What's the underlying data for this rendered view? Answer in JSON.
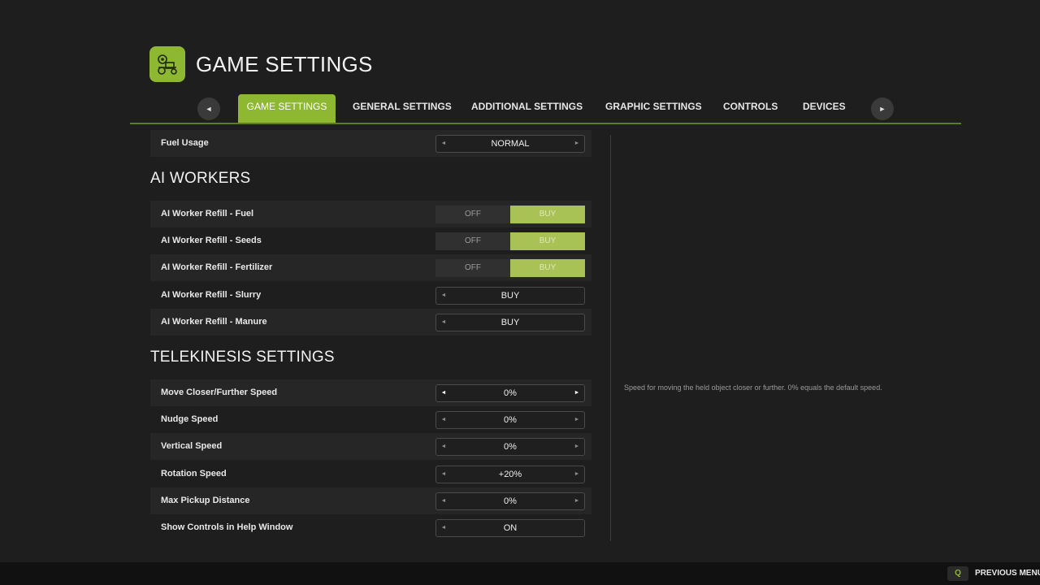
{
  "header": {
    "title": "GAME SETTINGS",
    "logo_icon": "tractor-gear-icon"
  },
  "tabs": [
    {
      "label": "GAME SETTINGS",
      "active": true
    },
    {
      "label": "GENERAL SETTINGS",
      "active": false
    },
    {
      "label": "ADDITIONAL SETTINGS",
      "active": false
    },
    {
      "label": "GRAPHIC SETTINGS",
      "active": false
    },
    {
      "label": "CONTROLS",
      "active": false
    },
    {
      "label": "DEVICES",
      "active": false
    }
  ],
  "tab_arrows": {
    "left": "◄",
    "right": "►"
  },
  "settings": {
    "fuel_usage": {
      "label": "Fuel Usage",
      "value": "NORMAL"
    },
    "ai_workers": {
      "title": "AI WORKERS",
      "toggles": [
        {
          "label": "AI Worker Refill - Fuel",
          "off": "OFF",
          "on": "BUY",
          "selected": "BUY"
        },
        {
          "label": "AI Worker Refill - Seeds",
          "off": "OFF",
          "on": "BUY",
          "selected": "BUY"
        },
        {
          "label": "AI Worker Refill - Fertilizer",
          "off": "OFF",
          "on": "BUY",
          "selected": "BUY"
        }
      ],
      "selectors": [
        {
          "label": "AI Worker Refill - Slurry",
          "value": "BUY"
        },
        {
          "label": "AI Worker Refill - Manure",
          "value": "BUY"
        }
      ]
    },
    "telekinesis": {
      "title": "TELEKINESIS SETTINGS",
      "rows": [
        {
          "label": "Move Closer/Further Speed",
          "value": "0%"
        },
        {
          "label": "Nudge Speed",
          "value": "0%"
        },
        {
          "label": "Vertical Speed",
          "value": "0%"
        },
        {
          "label": "Rotation Speed",
          "value": "+20%"
        },
        {
          "label": "Max Pickup Distance",
          "value": "0%"
        },
        {
          "label": "Show Controls in Help Window",
          "value": "ON"
        }
      ]
    }
  },
  "help_text": "Speed for moving the held object closer or further. 0% equals the default speed.",
  "footer": {
    "key": "Q",
    "label": "PREVIOUS MENU"
  },
  "colors": {
    "accent": "#8fb832",
    "toggle_on": "#a8c256",
    "background": "#1e1e1e"
  }
}
